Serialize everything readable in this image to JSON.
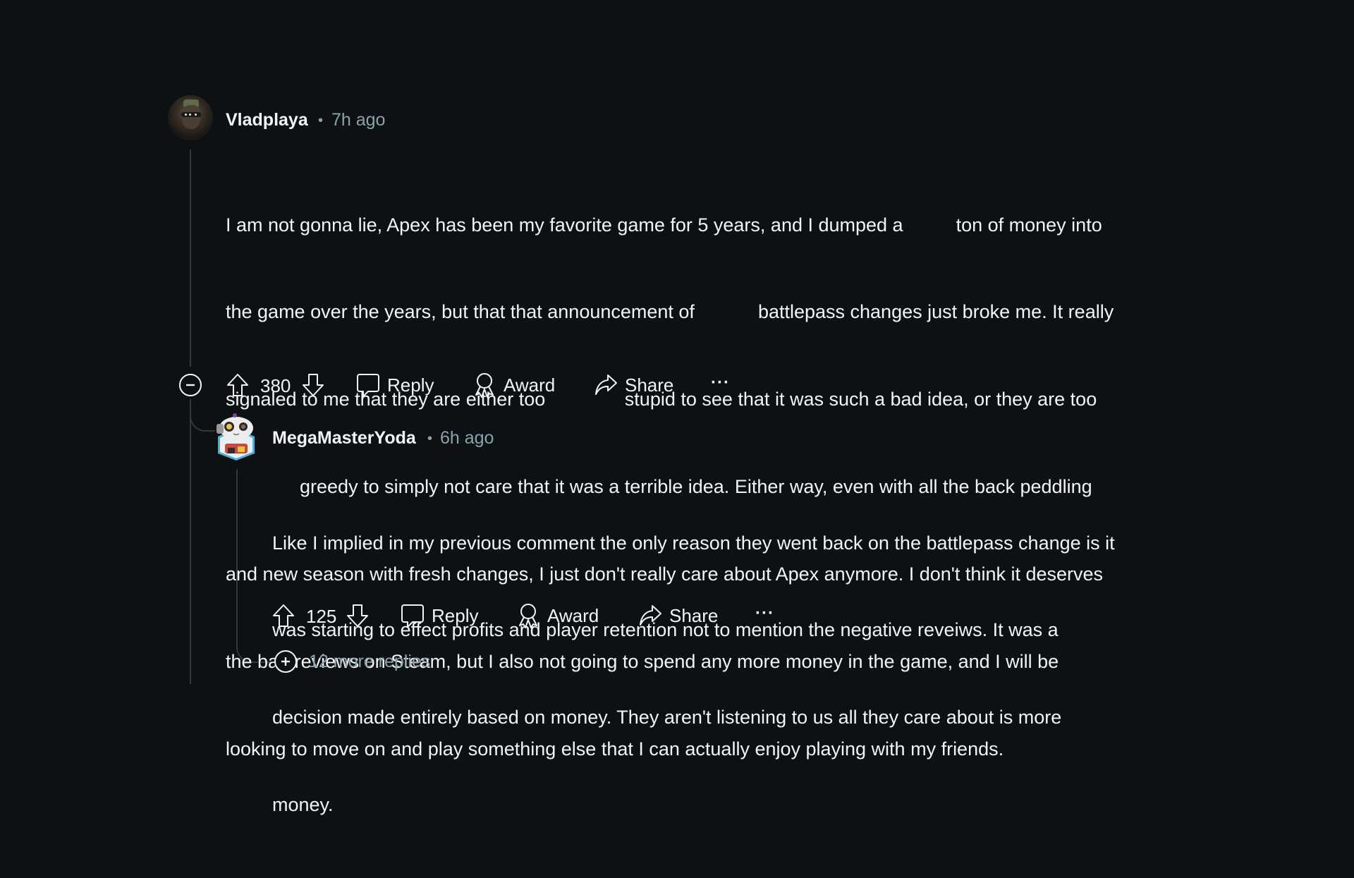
{
  "comments": [
    {
      "author": "Vladplaya",
      "separator": "•",
      "timestamp": "7h ago",
      "avatar_icon": "user-avatar-icon",
      "body_lines": [
        "I am not gonna lie, Apex has been my favorite game for 5 years, and I dumped a          ton of money into",
        "the game over the years, but that that announcement of            battlepass changes just broke me. It really",
        "signaled to me that they are either too               stupid to see that it was such a bad idea, or they are too",
        "              greedy to simply not care that it was a terrible idea. Either way, even with all the back peddling",
        "and new season with fresh changes, I just don't really care about Apex anymore. I don't think it deserves",
        "the bad reviews on Steam, but I also not going to spend any more money in the game, and I will be",
        "looking to move on and play something else that I can actually enjoy playing with my friends."
      ],
      "actions": {
        "collapse_icon": "minus-circle-icon",
        "upvote_icon": "upvote-arrow-icon",
        "vote_count": "380",
        "downvote_icon": "downvote-arrow-icon",
        "reply_label": "Reply",
        "award_label": "Award",
        "share_label": "Share",
        "more_label": "···"
      }
    },
    {
      "author": "MegaMasterYoda",
      "separator": "•",
      "timestamp": "6h ago",
      "avatar_icon": "snoo-avatar-icon",
      "body_lines": [
        "Like I implied in my previous comment the only reason they went back on the battlepass change is it",
        "was starting to effect profits and player retention not to mention the negative reveiws. It was a",
        "decision made entirely based on money. They aren't listening to us all they care about is more",
        "money."
      ],
      "actions": {
        "upvote_icon": "upvote-arrow-icon",
        "vote_count": "125",
        "downvote_icon": "downvote-arrow-icon",
        "reply_label": "Reply",
        "award_label": "Award",
        "share_label": "Share",
        "more_label": "···"
      },
      "more_replies_label": "12 more replies"
    }
  ],
  "colors": {
    "background": "#0e1113",
    "text": "#f2f4f5",
    "meta": "#8ba2ad",
    "thread_line": "#33383c"
  }
}
